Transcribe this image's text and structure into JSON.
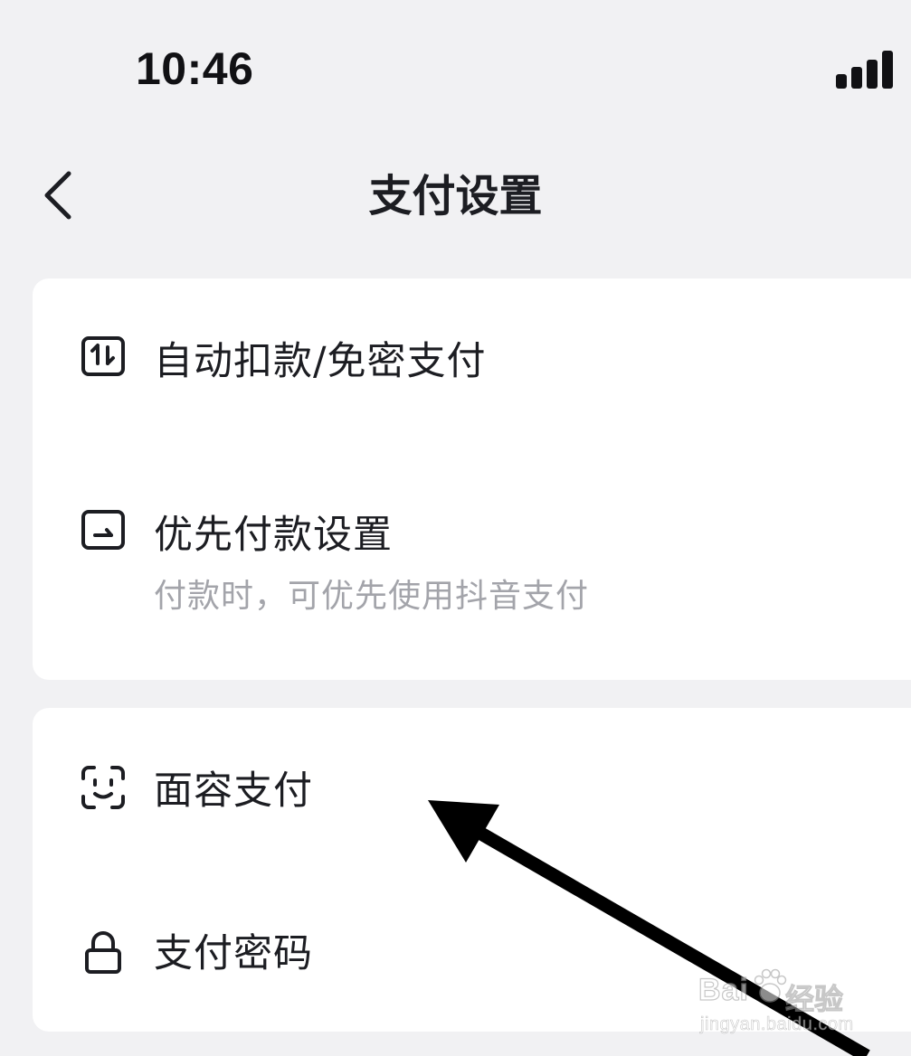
{
  "status_bar": {
    "time": "10:46",
    "signal_icon": "signal-bars-icon"
  },
  "nav": {
    "back_icon": "chevron-left-icon",
    "title": "支付设置"
  },
  "sections": [
    {
      "items": [
        {
          "icon": "auto-deduct-icon",
          "label": "自动扣款/免密支付"
        },
        {
          "icon": "priority-payment-icon",
          "label": "优先付款设置",
          "subtitle": "付款时，可优先使用抖音支付"
        }
      ]
    },
    {
      "items": [
        {
          "icon": "face-id-icon",
          "label": "面容支付"
        },
        {
          "icon": "lock-icon",
          "label": "支付密码"
        }
      ]
    }
  ],
  "annotation": {
    "type": "arrow",
    "points_to": "面容支付",
    "color": "#000000"
  },
  "watermark": {
    "brand": "Bai",
    "sub": "经验",
    "url": "jingyan.baidu.com"
  }
}
